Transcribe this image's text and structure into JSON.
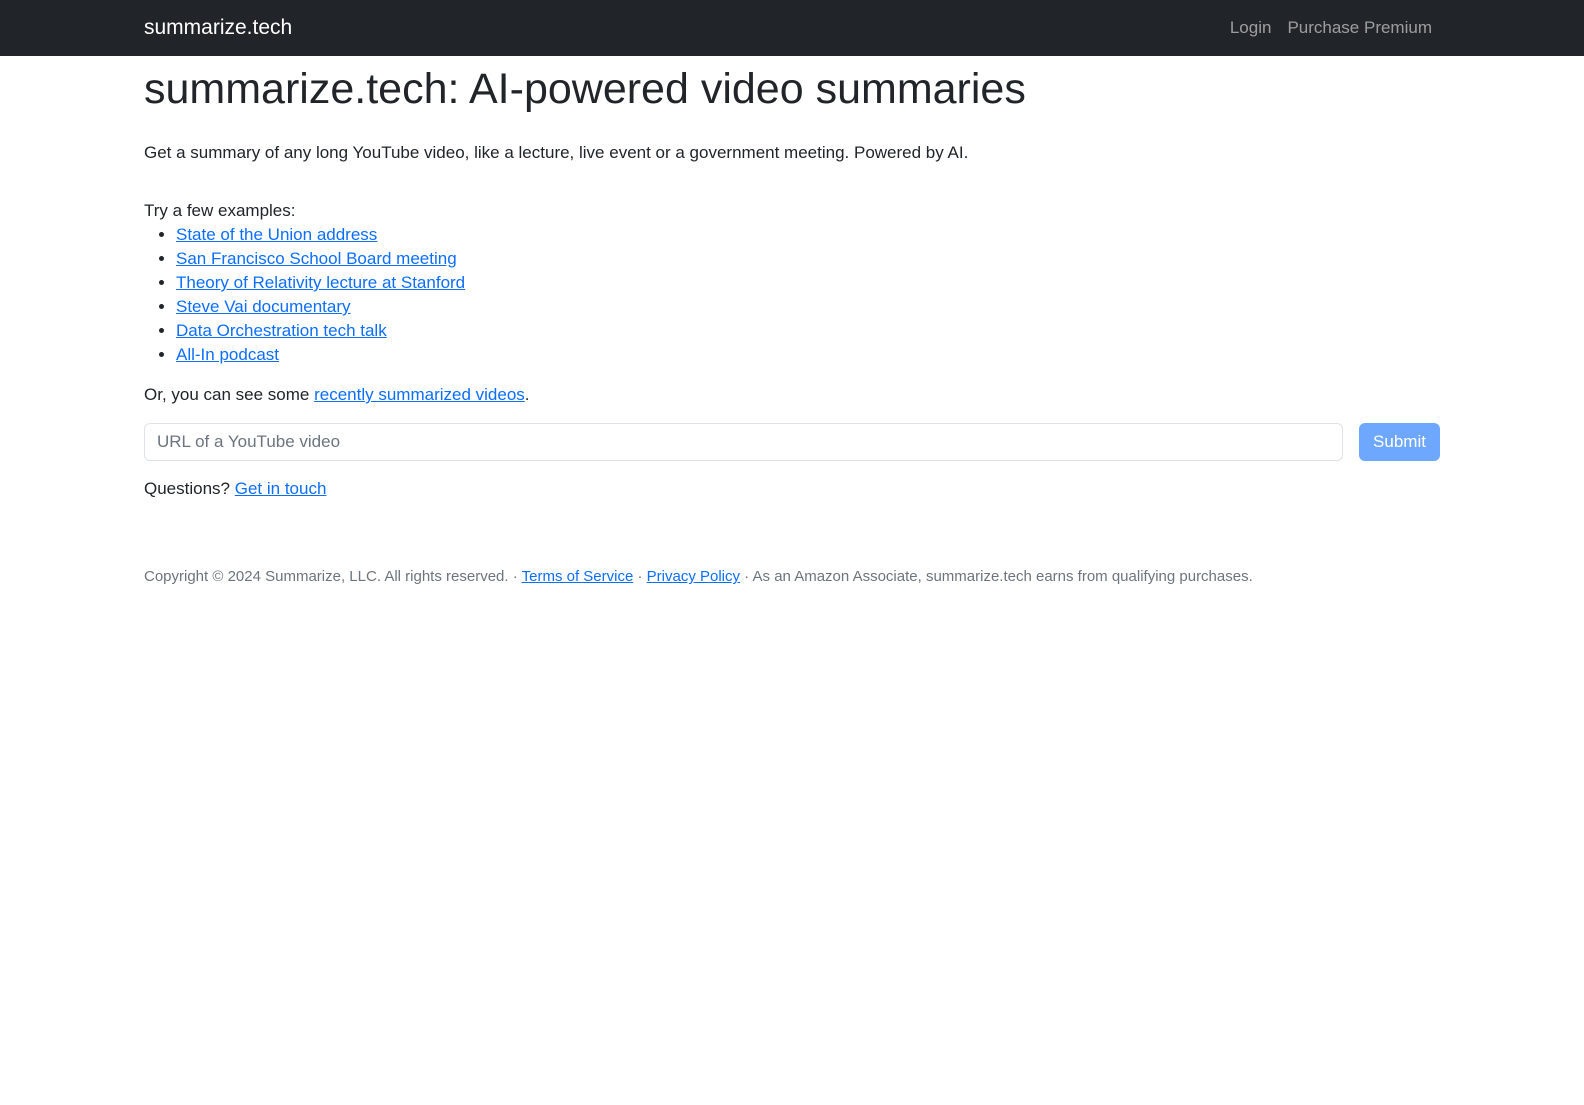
{
  "navbar": {
    "brand": "summarize.tech",
    "links": [
      {
        "label": "Login"
      },
      {
        "label": "Purchase Premium"
      }
    ]
  },
  "main": {
    "title": "summarize.tech: AI-powered video summaries",
    "lead": "Get a summary of any long YouTube video, like a lecture, live event or a government meeting. Powered by AI.",
    "examples_label": "Try a few examples:",
    "examples": [
      "State of the Union address",
      "San Francisco School Board meeting",
      "Theory of Relativity lecture at Stanford",
      "Steve Vai documentary",
      "Data Orchestration tech talk",
      "All-In podcast"
    ],
    "recent_prefix": "Or, you can see some ",
    "recent_link": "recently summarized videos",
    "recent_suffix": ".",
    "url_input": {
      "placeholder": "URL of a YouTube video",
      "value": ""
    },
    "submit_label": "Submit",
    "questions_prefix": "Questions? ",
    "questions_link": "Get in touch"
  },
  "footer": {
    "copyright": "Copyright © 2024 Summarize, LLC. All rights reserved. · ",
    "terms": "Terms of Service",
    "sep": " · ",
    "privacy": "Privacy Policy",
    "amazon": " · As an Amazon Associate, summarize.tech earns from qualifying purchases."
  },
  "colors": {
    "navbar_bg": "#212529",
    "link": "#0d6efd",
    "submit_bg": "#6ea8fe"
  }
}
